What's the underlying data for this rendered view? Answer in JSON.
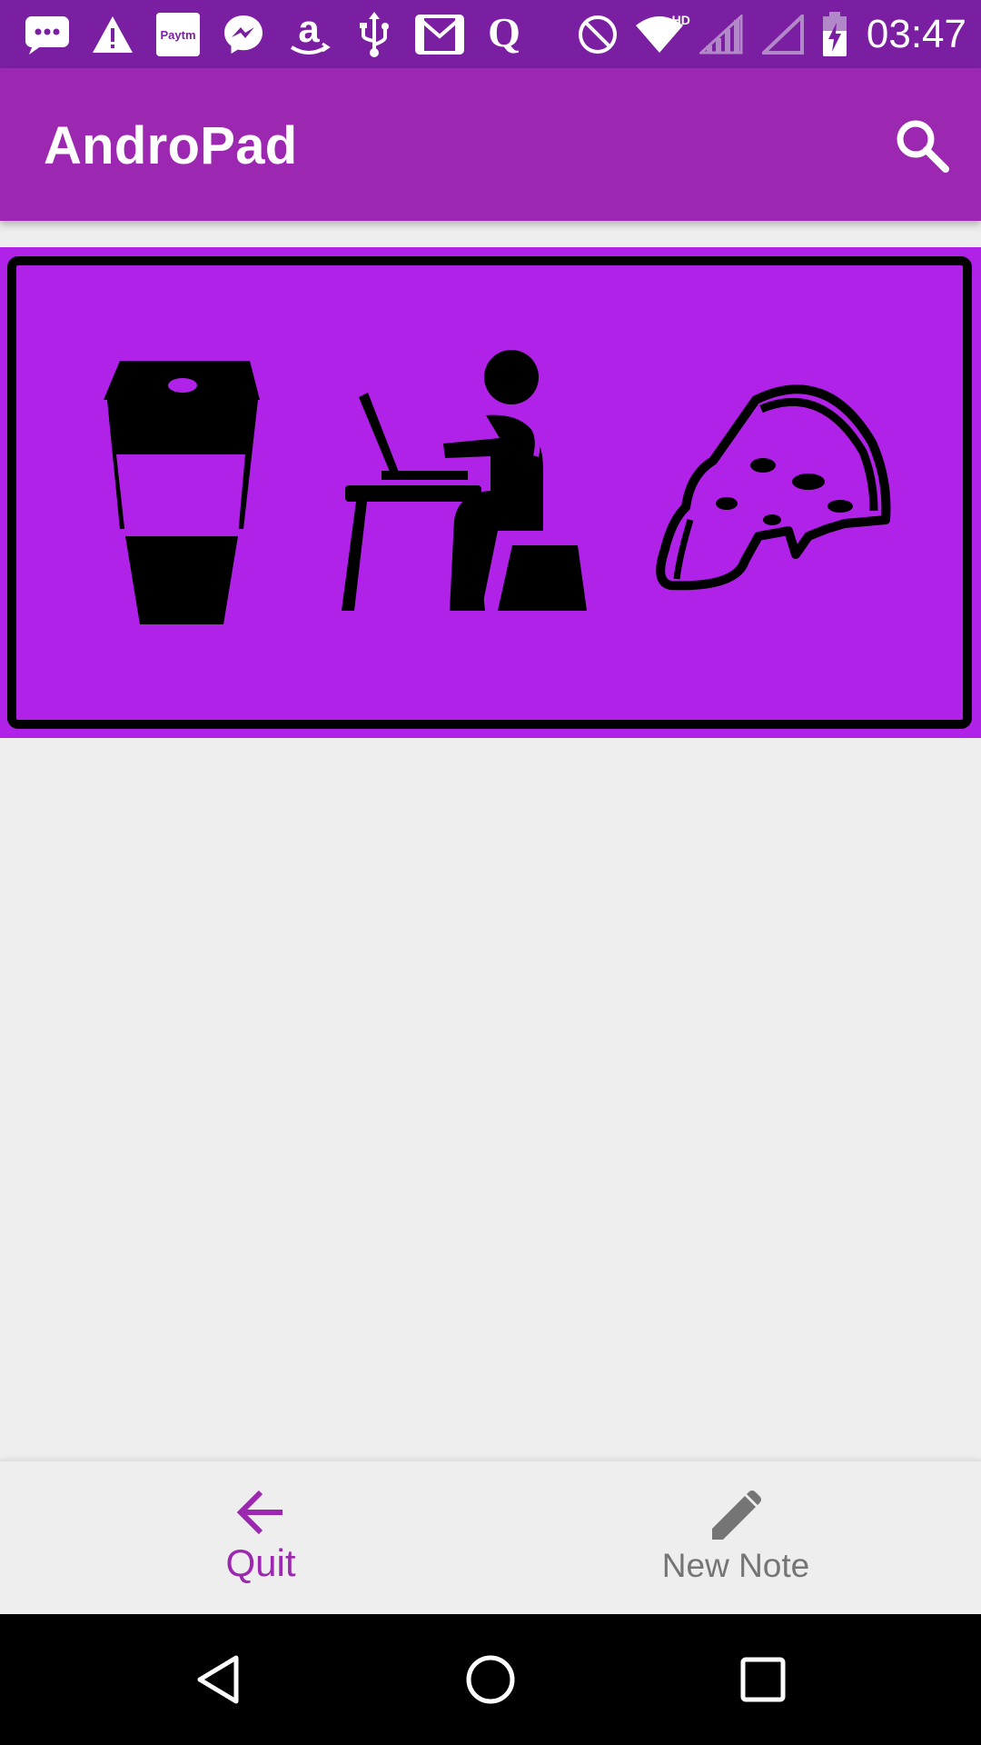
{
  "status_bar": {
    "time": "03:47",
    "notification_icons": [
      "sms-icon",
      "warning-icon",
      "paytm-icon",
      "messenger-icon",
      "amazon-icon",
      "usb-icon",
      "gmail-icon",
      "quora-icon"
    ],
    "paytm_text": "Paytm",
    "system_icons": [
      "do-not-disturb-icon",
      "wifi-icon",
      "cell-signal-icon",
      "cell-signal-empty-icon",
      "battery-charging-icon"
    ],
    "wifi_badge": "HD"
  },
  "app_bar": {
    "title": "AndroPad",
    "search_icon": "search-icon"
  },
  "banner": {
    "icons": [
      "coffee-cup-icon",
      "person-at-laptop-icon",
      "pizza-slice-icon"
    ]
  },
  "bottom_nav": {
    "items": [
      {
        "label": "Quit",
        "icon": "arrow-back-icon",
        "active": true
      },
      {
        "label": "New Note",
        "icon": "pencil-icon",
        "active": false
      }
    ]
  },
  "system_nav": {
    "buttons": [
      "back-triangle-icon",
      "home-circle-icon",
      "recents-square-icon"
    ]
  },
  "colors": {
    "status_bar": "#7b1fa2",
    "app_bar": "#9c27b0",
    "banner_bg": "#b122e8",
    "accent": "#9c27b0",
    "inactive": "#757575",
    "background": "#eeeeee"
  }
}
